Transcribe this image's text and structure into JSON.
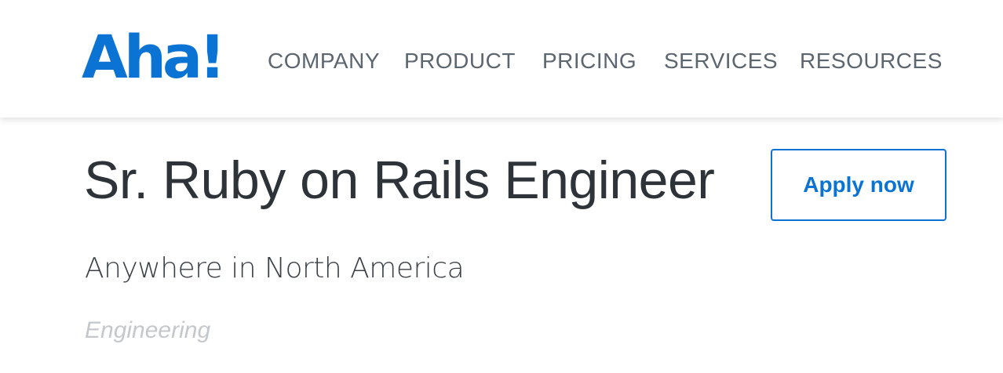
{
  "header": {
    "logo_text": "Aha!",
    "nav": [
      {
        "label": "COMPANY"
      },
      {
        "label": "PRODUCT"
      },
      {
        "label": "PRICING"
      },
      {
        "label": "SERVICES"
      },
      {
        "label": "RESOURCES"
      }
    ]
  },
  "job": {
    "title": "Sr. Ruby on Rails Engineer",
    "location": "Anywhere in North America",
    "department": "Engineering",
    "apply_label": "Apply now"
  },
  "colors": {
    "brand_blue": "#0a73d4",
    "nav_text": "#5c6670",
    "heading_text": "#2d3338",
    "muted_text": "#c4c8cc"
  }
}
